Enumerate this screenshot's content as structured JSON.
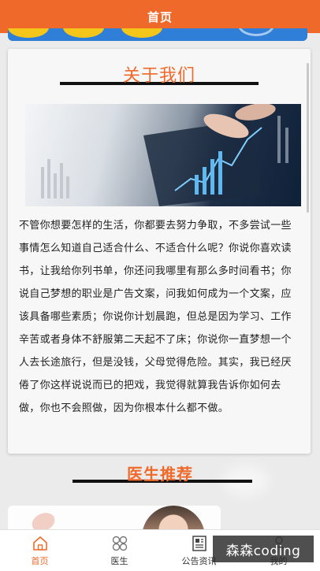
{
  "header": {
    "title": "首页"
  },
  "about": {
    "title": "关于我们",
    "body": "不管你想要怎样的生活，你都要去努力争取，不多尝试一些事情怎么知道自己适合什么、不适合什么呢？你说你喜欢读书，让我给你列书单，你还问我哪里有那么多时间看书；你说自己梦想的职业是广告文案，问我如何成为一个文案，应该具备哪些素质；你说你计划晨跑，但总是因为学习、工作辛苦或者身体不舒服第二天起不了床；你说你一直梦想一个人去长途旅行，但是没钱，父母觉得危险。其实，我已经厌倦了你这样说说而已的把戏，我觉得就算我告诉你如何去做，你也不会照做，因为你根本什么都不做。"
  },
  "doctors": {
    "title": "医生推荐"
  },
  "nav": {
    "items": [
      {
        "label": "首页",
        "icon": "home-icon",
        "active": true
      },
      {
        "label": "医生",
        "icon": "grid-icon",
        "active": false
      },
      {
        "label": "公告资讯",
        "icon": "notice-icon",
        "active": false
      },
      {
        "label": "我的",
        "icon": "user-icon",
        "active": false
      }
    ]
  },
  "watermark": {
    "text": "森森coding"
  },
  "colors": {
    "accent": "#ef6a2a",
    "banner": "#2f7ed8",
    "active_nav": "#ef6a2a"
  }
}
